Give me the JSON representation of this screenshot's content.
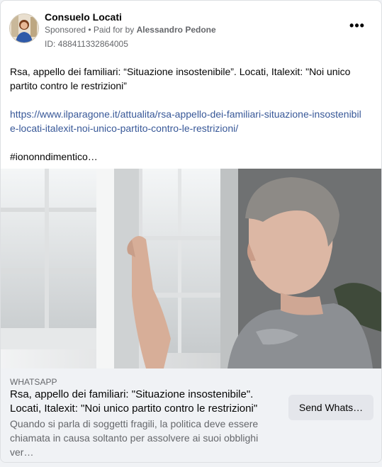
{
  "post": {
    "author": "Consuelo Locati",
    "sponsored": "Sponsored",
    "paid_for_prefix": " • Paid for by ",
    "payer": "Alessandro Pedone",
    "ad_id": "ID: 488411332864005",
    "more_icon": "•••",
    "text_line1": "Rsa, appello dei familiari: “Situazione insostenibile”. Locati, Italexit: \"Noi unico partito contro le restrizioni”",
    "url": "https://www.ilparagone.it/attualita/rsa-appello-dei-familiari-situazione-insostenibile-locati-italexit-noi-unico-partito-contro-le-restrizioni/",
    "hashtag": "#iononndimentico…"
  },
  "link_preview": {
    "domain": "WHATSAPP",
    "title": "Rsa, appello dei familiari: \"Situazione insostenibile\". Locati, Italexit: \"Noi unico partito contro le restrizioni\"",
    "description": "Quando si parla di soggetti fragili, la politica deve essere chiamata in causa soltanto per assolvere ai suoi obblighi ver…",
    "cta_label": "Send Whats…"
  }
}
